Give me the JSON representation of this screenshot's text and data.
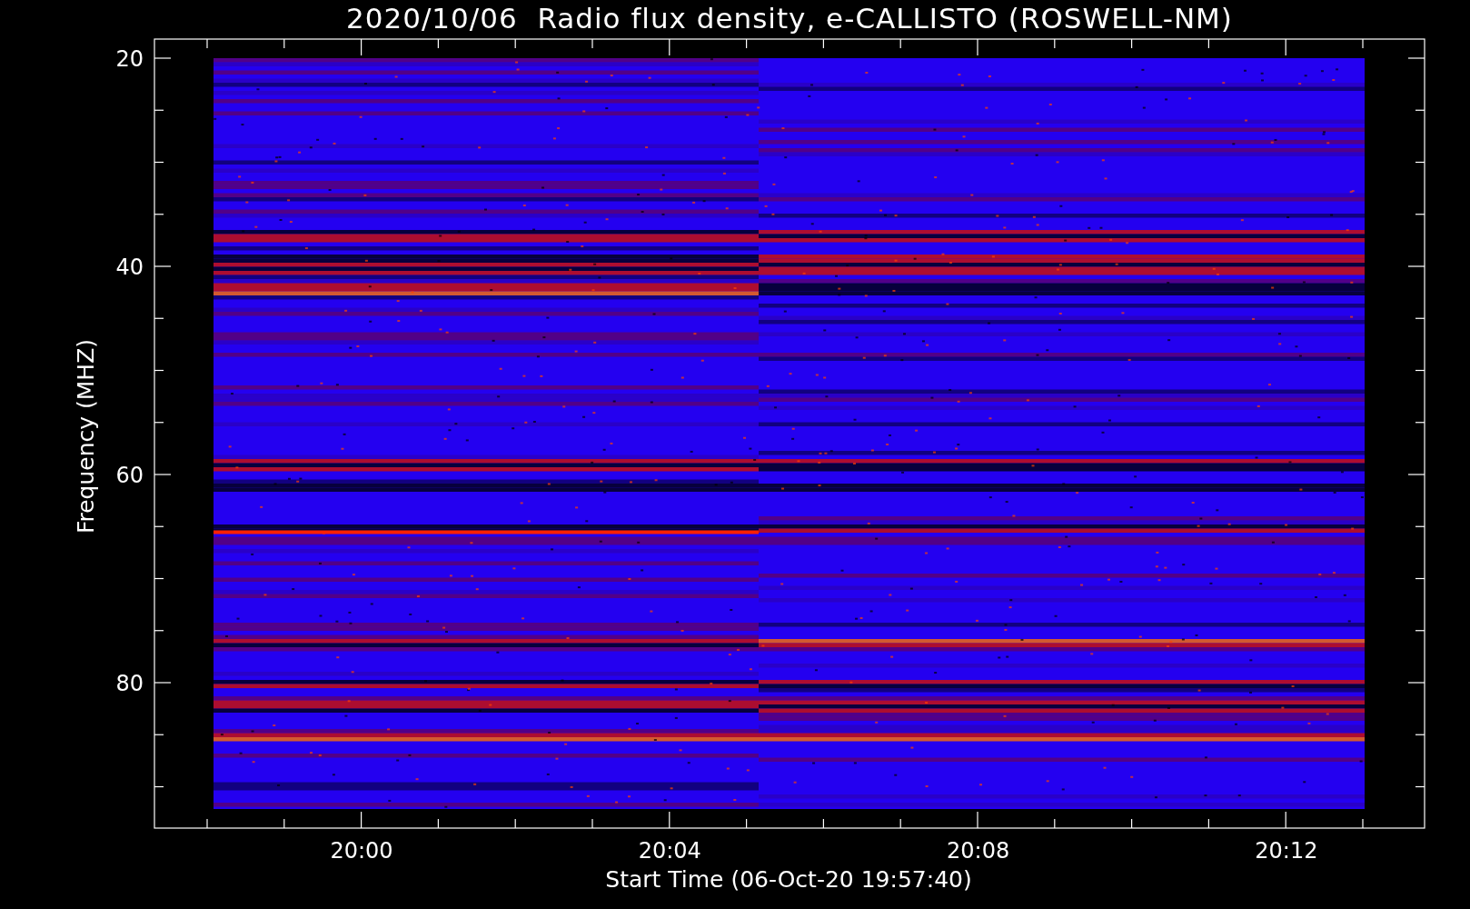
{
  "title": "2020/10/06  Radio flux density, e-CALLISTO (ROSWELL-NM)",
  "plot": {
    "ylabel": "Frequency (MHZ)",
    "xlabel": "Start Time (06-Oct-20 19:57:40)",
    "yticks": [
      "20",
      "40",
      "60",
      "80"
    ],
    "xticks": [
      "20:00",
      "20:04",
      "20:08",
      "20:12"
    ]
  }
}
